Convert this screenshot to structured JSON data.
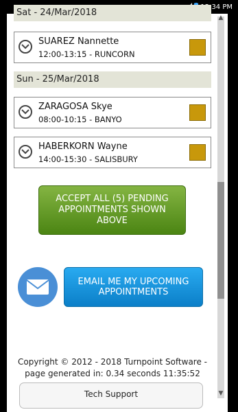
{
  "status_bar": {
    "time": "12:34 PM",
    "colors": {
      "background": "#000000",
      "text": "#ffffff"
    }
  },
  "schedule": {
    "day_headers": [
      {
        "label": "Sat - 24/Mar/2018"
      },
      {
        "label": "Sun - 25/Mar/2018"
      }
    ],
    "appointments": [
      {
        "name": "SUAREZ Nannette",
        "time_location": "12:00-13:15 - RUNCORN"
      },
      {
        "name": "ZARAGOSA Skye",
        "time_location": "08:00-10:15 - BANYO"
      },
      {
        "name": "HABERKORN Wayne",
        "time_location": "14:00-15:30 - SALISBURY"
      }
    ],
    "status_color": "#c8980b"
  },
  "actions": {
    "accept_label": "ACCEPT ALL (5) PENDING APPOINTMENTS SHOWN ABOVE",
    "email_label": "EMAIL ME MY UPCOMING APPOINTMENTS",
    "accept_color": "#5a961f",
    "email_color": "#1697de"
  },
  "footer": {
    "copyright": "Copyright © 2012 - 2018 Turnpoint Software - page generated in: 0.34 seconds 11:35:52",
    "tech_support_label": "Tech Support"
  },
  "icons": {
    "expand": "chevron-down-icon",
    "mail": "envelope-icon",
    "battery": "battery-icon",
    "signal": "signal-icon"
  }
}
